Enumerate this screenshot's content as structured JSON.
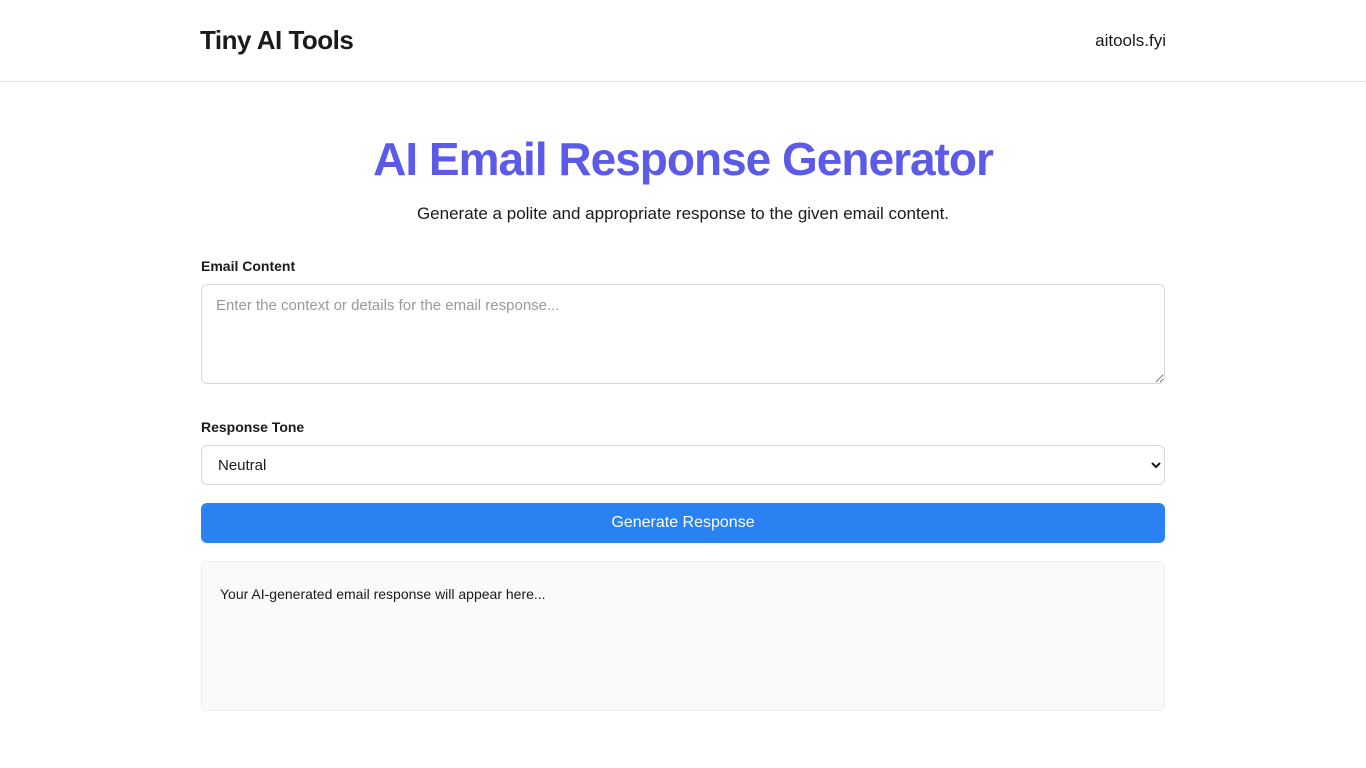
{
  "header": {
    "brand": "Tiny AI Tools",
    "link": "aitools.fyi"
  },
  "page": {
    "title": "AI Email Response Generator",
    "subtitle": "Generate a polite and appropriate response to the given email content."
  },
  "form": {
    "emailContent": {
      "label": "Email Content",
      "placeholder": "Enter the context or details for the email response...",
      "value": ""
    },
    "responseTone": {
      "label": "Response Tone",
      "selected": "Neutral"
    },
    "submit": {
      "label": "Generate Response"
    }
  },
  "output": {
    "placeholder": "Your AI-generated email response will appear here..."
  }
}
